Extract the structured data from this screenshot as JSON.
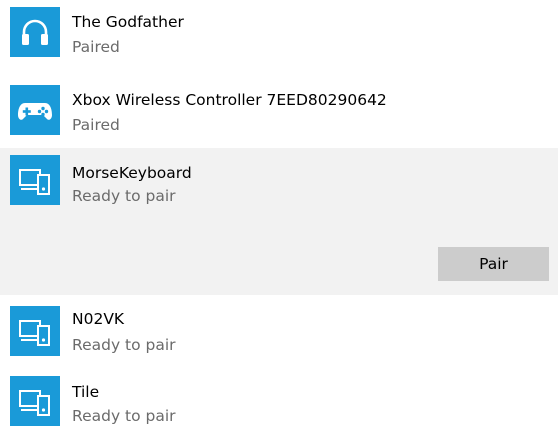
{
  "colors": {
    "icon_bg": "#1a9ad8",
    "selected_bg": "#f2f2f2",
    "button_bg": "#cccccc",
    "status_text": "#6b6b6b"
  },
  "devices": [
    {
      "name": "The Godfather",
      "status": "Paired",
      "icon": "headphones-icon"
    },
    {
      "name": "Xbox Wireless Controller 7EED80290642",
      "status": "Paired",
      "icon": "gamepad-icon"
    },
    {
      "name": "MorseKeyboard",
      "status": "Ready to pair",
      "icon": "devices-icon",
      "selected": true,
      "action_label": "Pair"
    },
    {
      "name": "N02VK",
      "status": "Ready to pair",
      "icon": "devices-icon"
    },
    {
      "name": "Tile",
      "status": "Ready to pair",
      "icon": "devices-icon"
    }
  ]
}
